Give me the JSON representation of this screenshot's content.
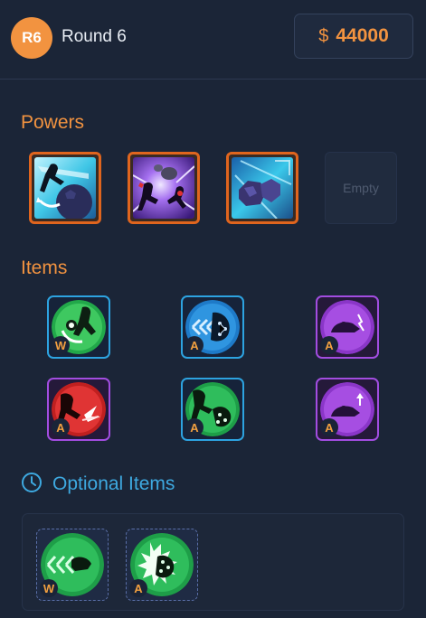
{
  "header": {
    "round_badge": "R6",
    "round_label": "Round 6",
    "currency_symbol": "$",
    "money": "44000"
  },
  "powers": {
    "title": "Powers",
    "slots": [
      {
        "icon": "kick-power-icon",
        "filled": true
      },
      {
        "icon": "brawl-power-icon",
        "filled": true
      },
      {
        "icon": "rock-shield-power-icon",
        "filled": true
      },
      {
        "label": "Empty",
        "filled": false
      }
    ]
  },
  "items": {
    "title": "Items",
    "list": [
      {
        "icon": "green-spin-item-icon",
        "tier": "W",
        "rarity": "blue"
      },
      {
        "icon": "blue-dash-item-icon",
        "tier": "A",
        "rarity": "blue"
      },
      {
        "icon": "purple-charge-item-icon",
        "tier": "A",
        "rarity": "purple"
      },
      {
        "icon": "red-burst-item-icon",
        "tier": "A",
        "rarity": "purple"
      },
      {
        "icon": "green-strike-item-icon",
        "tier": "A",
        "rarity": "blue"
      },
      {
        "icon": "purple-boost-item-icon",
        "tier": "A",
        "rarity": "purple"
      }
    ]
  },
  "optional": {
    "title": "Optional Items",
    "list": [
      {
        "icon": "green-dash-shot-icon",
        "tier": "W"
      },
      {
        "icon": "green-burst-icon",
        "tier": "A"
      }
    ]
  },
  "colors": {
    "accent": "#f29340",
    "blue_accent": "#3ea9e0",
    "rare_blue": "#2da3e0",
    "rare_purple": "#a24de0",
    "background": "#1b2537"
  }
}
